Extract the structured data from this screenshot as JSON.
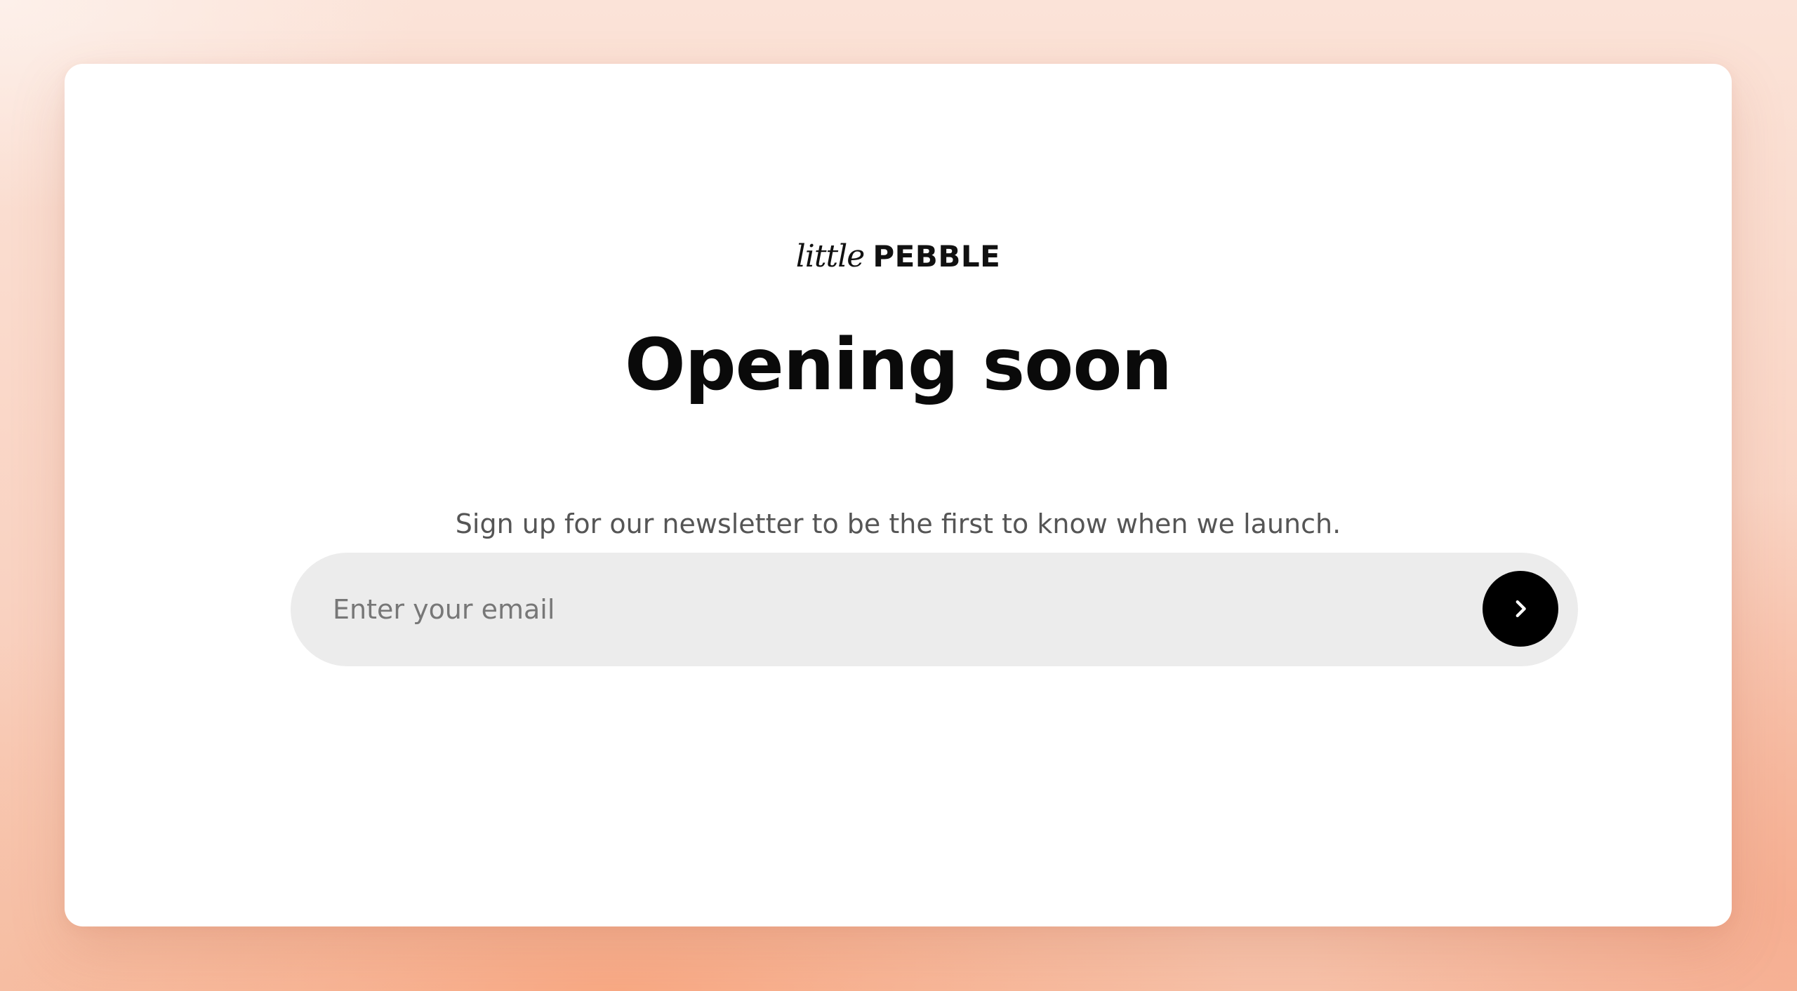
{
  "brand": {
    "script": "little",
    "word": "PEBBLE"
  },
  "hero": {
    "title": "Opening soon",
    "subtitle": "Sign up for our newsletter to be the first to know when we launch."
  },
  "newsletter": {
    "email_placeholder": "Enter your email",
    "email_value": "",
    "submit_icon": "chevron-right-icon"
  },
  "colors": {
    "card": "#ffffff",
    "input_bg": "#ececec",
    "button": "#000000",
    "text": "#0a0a0a",
    "subtext": "#555555",
    "background_peach": "#f8a984"
  }
}
